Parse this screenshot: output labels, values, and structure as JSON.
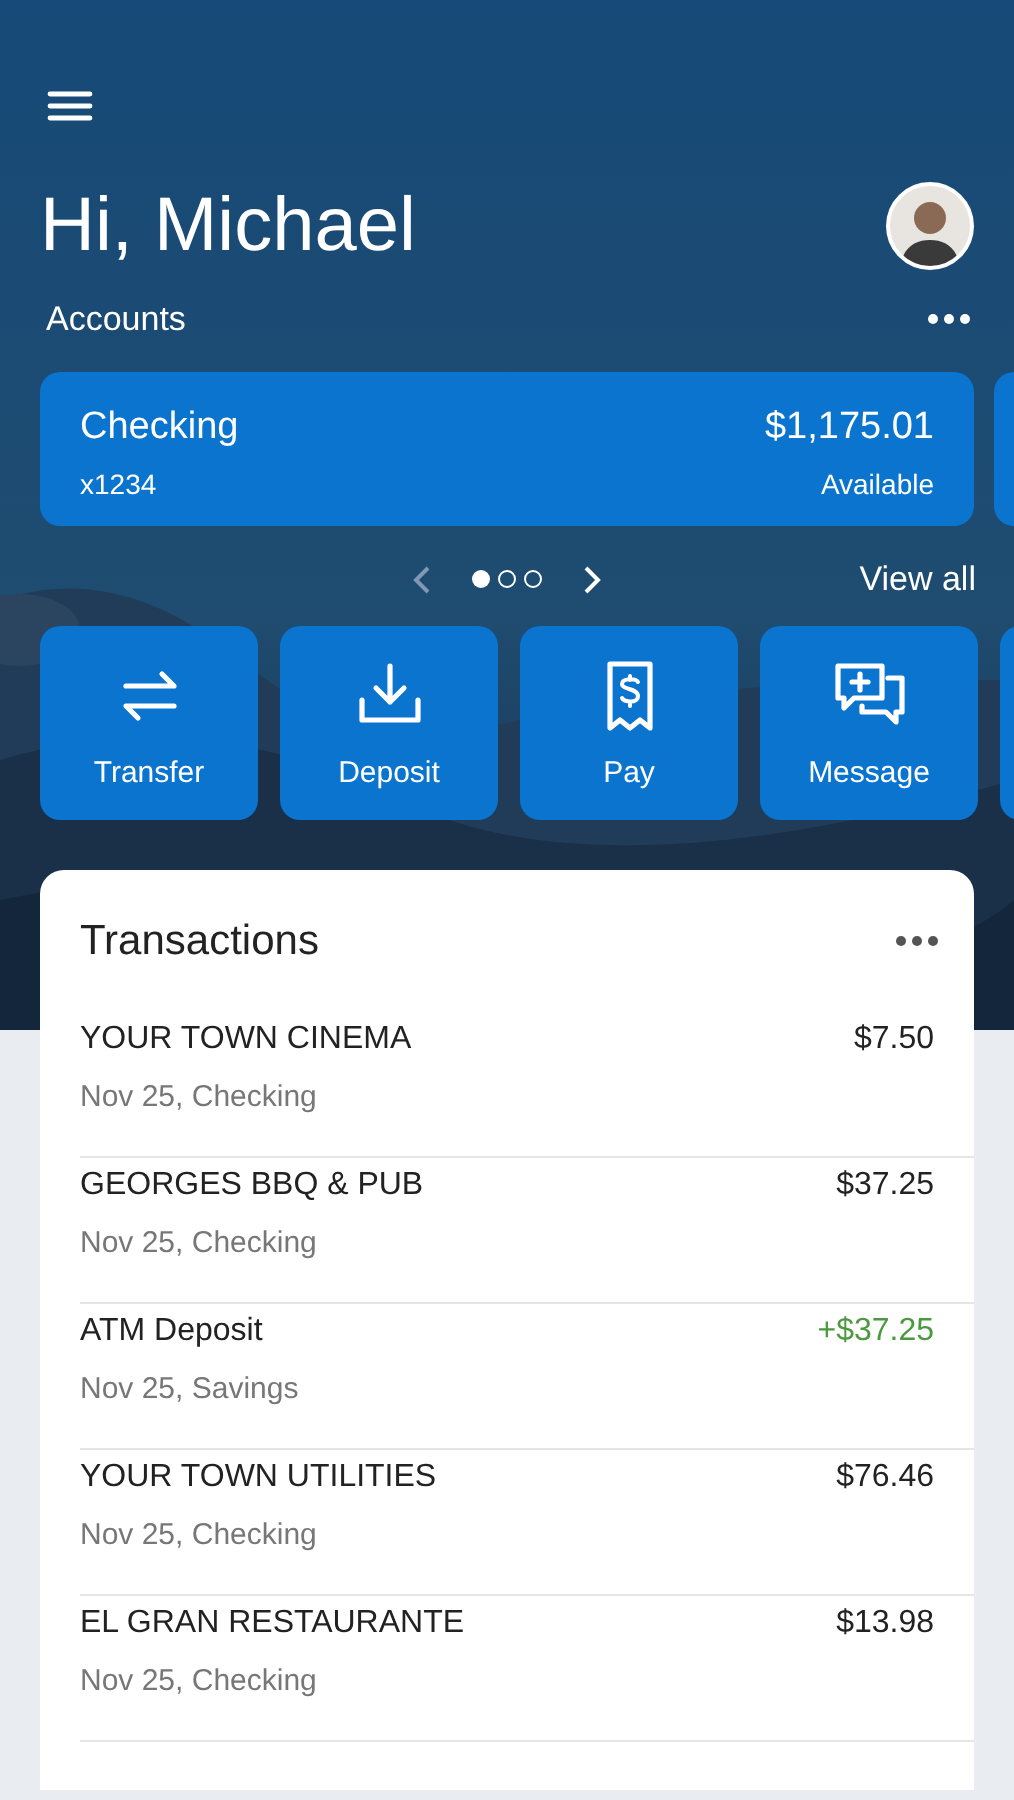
{
  "greeting": "Hi, Michael",
  "accounts": {
    "label": "Accounts",
    "cards": [
      {
        "name": "Checking",
        "number": "x1234",
        "balance": "$1,175.01",
        "balance_label": "Available"
      }
    ],
    "pager": [
      {
        "selected": true
      },
      {
        "selected": false
      },
      {
        "selected": false
      }
    ],
    "view_all": "View all"
  },
  "actions": [
    {
      "label": "Transfer",
      "kind": "transfer"
    },
    {
      "label": "Deposit",
      "kind": "deposit"
    },
    {
      "label": "Pay",
      "kind": "pay"
    },
    {
      "label": "Message",
      "kind": "message"
    }
  ],
  "transactions": {
    "title": "Transactions",
    "items": [
      {
        "name": "YOUR TOWN CINEMA",
        "detail": "Nov 25, Checking",
        "amount": "$7.50",
        "kind": "debit"
      },
      {
        "name": "GEORGES BBQ & PUB",
        "detail": "Nov 25, Checking",
        "amount": "$37.25",
        "kind": "debit"
      },
      {
        "name": "ATM Deposit",
        "detail": "Nov 25, Savings",
        "amount": "+$37.25",
        "kind": "credit"
      },
      {
        "name": "YOUR TOWN UTILITIES",
        "detail": "Nov 25, Checking",
        "amount": "$76.46",
        "kind": "debit"
      },
      {
        "name": "EL GRAN RESTAURANTE",
        "detail": "Nov 25, Checking",
        "amount": "$13.98",
        "kind": "debit"
      }
    ]
  }
}
